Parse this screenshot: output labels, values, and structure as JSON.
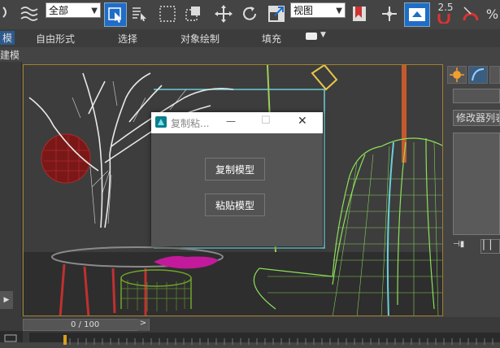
{
  "toolbar": {
    "selection_filter": "全部",
    "reference_coord": "视图",
    "spinner_value": "2.5",
    "percent_symbol": "%"
  },
  "ribbon": {
    "tab_modeling_partial": "模",
    "items": [
      "自由形式",
      "选择",
      "对象绘制",
      "填充"
    ]
  },
  "subrow": {
    "label": "建模"
  },
  "dialog": {
    "title": "复制粘...",
    "copy_button": "复制模型",
    "paste_button": "粘贴模型",
    "minimize": "—",
    "maximize": "☐",
    "close": "✕"
  },
  "right_panel": {
    "modifier_list": "修改器列表"
  },
  "timeline": {
    "frame_counter": "0 / 100",
    "prev": "<",
    "next": ">"
  },
  "colors": {
    "accent_blue": "#1f6dc8",
    "viewport_border": "#a08030",
    "chair_green": "#8ee05a",
    "tree_white": "#e8e8e8"
  }
}
